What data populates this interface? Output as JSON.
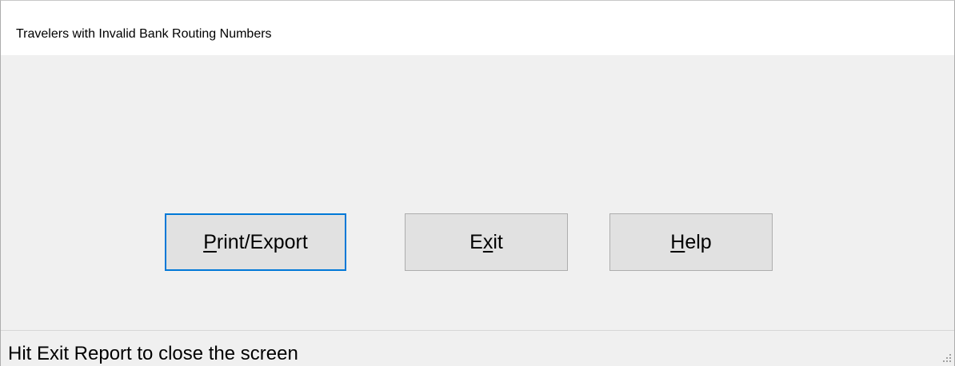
{
  "window": {
    "title": "Travelers with Invalid Bank Routing Numbers"
  },
  "buttons": {
    "print_export": {
      "label_mnemonic": "P",
      "label_rest": "rint/Export"
    },
    "exit": {
      "label_pre": "E",
      "label_mnemonic": "x",
      "label_post": "it"
    },
    "help": {
      "label_mnemonic": "H",
      "label_rest": "elp"
    }
  },
  "statusbar": {
    "text": "Hit Exit Report to close the screen"
  },
  "colors": {
    "default_button_border": "#0078d7",
    "button_face": "#e1e1e1",
    "window_background": "#f0f0f0"
  },
  "icons": {
    "resize_grip": "resize-grip-icon"
  }
}
